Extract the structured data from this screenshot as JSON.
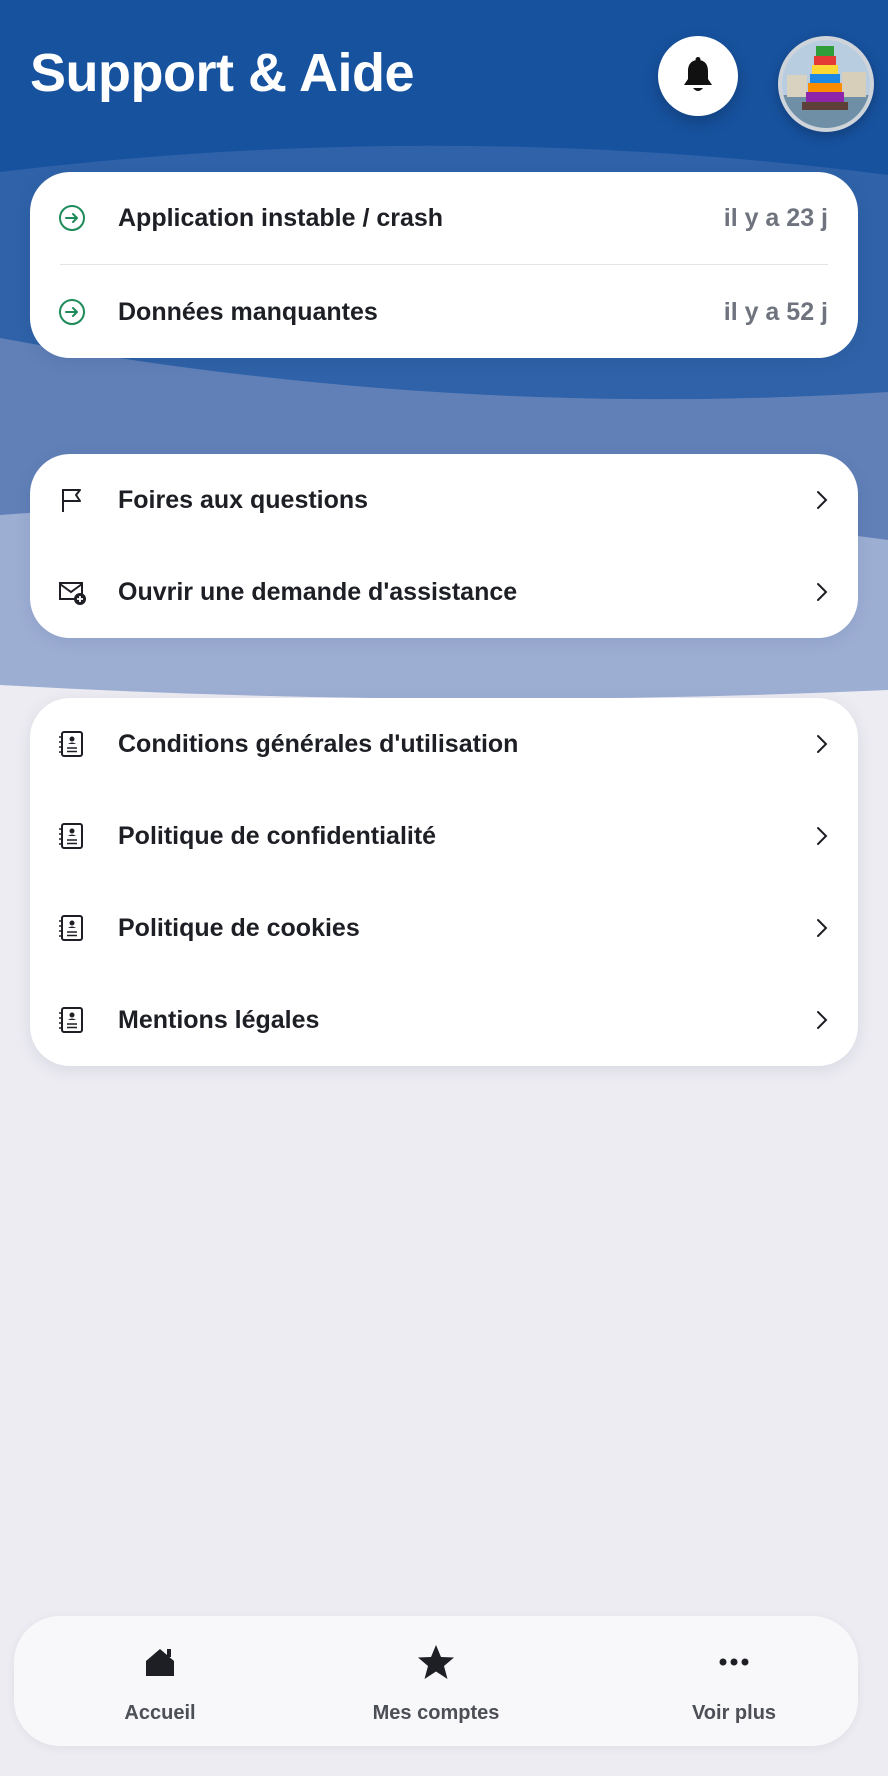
{
  "header": {
    "title": "Support & Aide"
  },
  "tickets": [
    {
      "label": "Application instable / crash",
      "age": "il y a 23 j"
    },
    {
      "label": "Données manquantes",
      "age": "il y a 52 j"
    }
  ],
  "help": [
    {
      "label": "Foires aux questions"
    },
    {
      "label": "Ouvrir une demande d'assistance"
    }
  ],
  "legal": [
    {
      "label": "Conditions générales d'utilisation"
    },
    {
      "label": "Politique de confidentialité"
    },
    {
      "label": "Politique de cookies"
    },
    {
      "label": "Mentions légales"
    }
  ],
  "nav": [
    {
      "label": "Accueil",
      "icon": "home-icon"
    },
    {
      "label": "Mes comptes",
      "icon": "star-icon"
    },
    {
      "label": "Voir plus",
      "icon": "more-icon"
    }
  ],
  "colors": {
    "header_blue": "#17529f",
    "accent_green": "#1d8a5a",
    "background": "#edecf2"
  }
}
